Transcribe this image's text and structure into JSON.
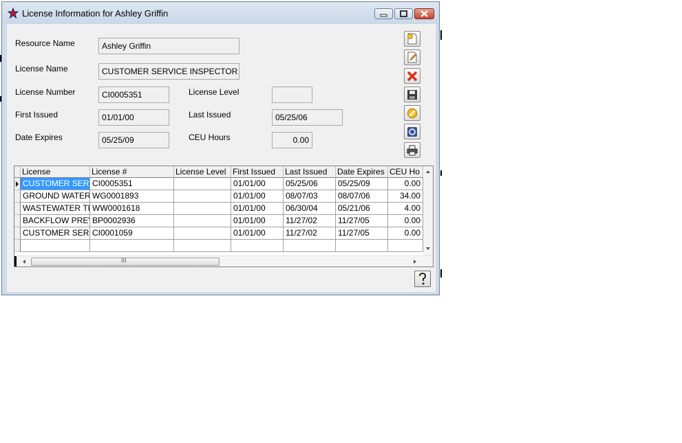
{
  "window": {
    "title": "License Information for Ashley Griffin"
  },
  "form": {
    "resource_name_label": "Resource Name",
    "resource_name_value": "Ashley Griffin",
    "license_name_label": "License Name",
    "license_name_value": "CUSTOMER SERVICE INSPECTOR",
    "license_number_label": "License Number",
    "license_number_value": "CI0005351",
    "license_level_label": "License Level",
    "license_level_value": "",
    "first_issued_label": "First Issued",
    "first_issued_value": "01/01/00",
    "last_issued_label": "Last Issued",
    "last_issued_value": "05/25/06",
    "date_expires_label": "Date Expires",
    "date_expires_value": "05/25/09",
    "ceu_hours_label": "CEU Hours",
    "ceu_hours_value": "0.00"
  },
  "toolbar": {
    "icons": [
      "new-record-icon",
      "edit-record-icon",
      "delete-record-icon",
      "save-record-icon",
      "cancel-icon",
      "refresh-icon",
      "print-icon"
    ]
  },
  "grid": {
    "columns": [
      "License",
      "License #",
      "License Level",
      "First Issued",
      "Last Issued",
      "Date Expires",
      "CEU Ho"
    ],
    "rows": [
      [
        "CUSTOMER SER",
        "CI0005351",
        "",
        "01/01/00",
        "05/25/06",
        "05/25/09",
        "0.00"
      ],
      [
        "GROUND WATER",
        "WG0001893",
        "",
        "01/01/00",
        "08/07/03",
        "08/07/06",
        "34.00"
      ],
      [
        "WASTEWATER TF",
        "WW0001618",
        "",
        "01/01/00",
        "06/30/04",
        "05/21/06",
        "4.00"
      ],
      [
        "BACKFLOW PREV",
        "BP0002936",
        "",
        "01/01/00",
        "11/27/02",
        "11/27/05",
        "0.00"
      ],
      [
        "CUSTOMER SER",
        "CI0001059",
        "",
        "01/01/00",
        "11/27/02",
        "11/27/05",
        "0.00"
      ]
    ],
    "selected_row": 0,
    "scroll_grip": "III"
  },
  "colors": {
    "selection": "#3399ff",
    "window_frame": "#cfdcec",
    "close_button": "#c4462d"
  }
}
